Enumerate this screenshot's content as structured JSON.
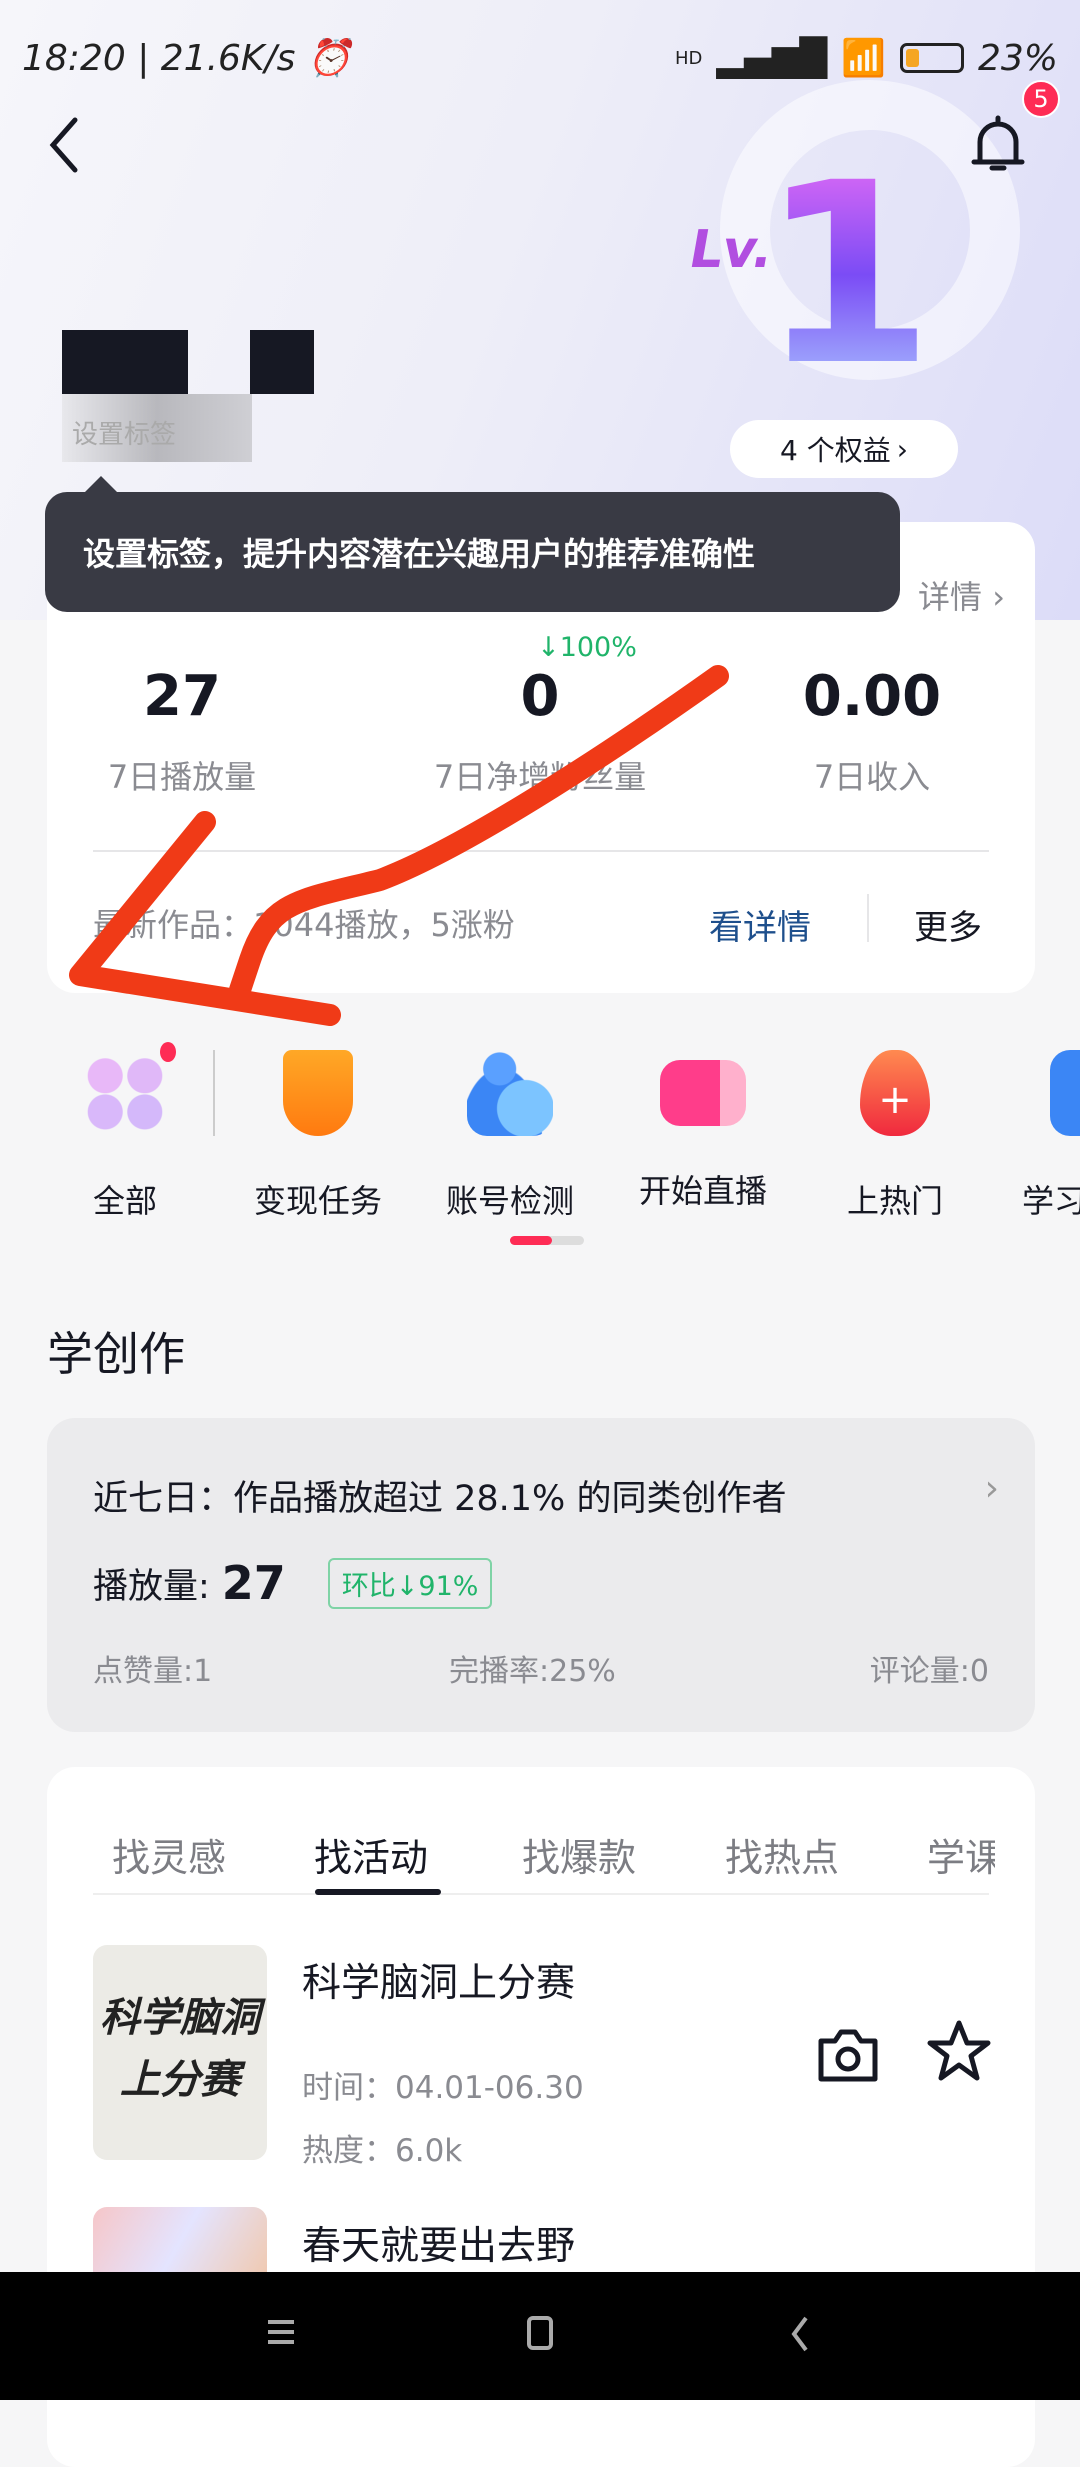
{
  "status_bar": {
    "time": "18:20",
    "speed": "21.6K/s",
    "network": "HD",
    "battery": "23%",
    "battery_level": 0.23
  },
  "header": {
    "back_icon": "chevron-left-icon",
    "bell_icon": "bell-icon",
    "notification_count": "5"
  },
  "level": {
    "prefix": "Lv.",
    "number": "1",
    "benefits": "4 个权益"
  },
  "profile": {
    "set_tag": "设置标签"
  },
  "tooltip": "设置标签，提升内容潜在兴趣用户的推荐准确性",
  "overview": {
    "details_link": "详情",
    "change": "↓100%",
    "stats": [
      {
        "value": "27",
        "label": "7日播放量"
      },
      {
        "value": "0",
        "label": "7日净增粉丝量"
      },
      {
        "value": "0.00",
        "label": "7日收入"
      }
    ],
    "latest": "最新作品：1044播放，5涨粉",
    "view_details": "看详情",
    "more": "更多"
  },
  "tools": [
    {
      "label": "全部",
      "icon": "grid-icon"
    },
    {
      "label": "变现任务",
      "icon": "trophy-icon"
    },
    {
      "label": "账号检测",
      "icon": "account-check-icon"
    },
    {
      "label": "开始直播",
      "icon": "video-camera-icon"
    },
    {
      "label": "上热门",
      "icon": "fire-icon"
    },
    {
      "label": "学习",
      "icon": "book-icon"
    }
  ],
  "learn": {
    "title": "学创作",
    "summary": "近七日：作品播放超过 28.1% 的同类创作者",
    "plays_label": "播放量:",
    "plays": "27",
    "ratio": "环比↓91%",
    "likes": "点赞量:1",
    "completion": "完播率:25%",
    "comments": "评论量:0"
  },
  "tabs": {
    "items": [
      "找灵感",
      "找活动",
      "找爆款",
      "找热点",
      "学课程"
    ],
    "active": 1
  },
  "activities": [
    {
      "title": "科学脑洞上分赛",
      "thumb_text": "科学脑洞上分赛",
      "time": "时间：04.01-06.30",
      "heat": "热度：6.0k"
    },
    {
      "title": "春天就要出去野"
    }
  ],
  "colors": {
    "accent": "#fe2c55",
    "green": "#20b46a",
    "link": "#1e4f8c",
    "annotation": "#f03a17"
  }
}
